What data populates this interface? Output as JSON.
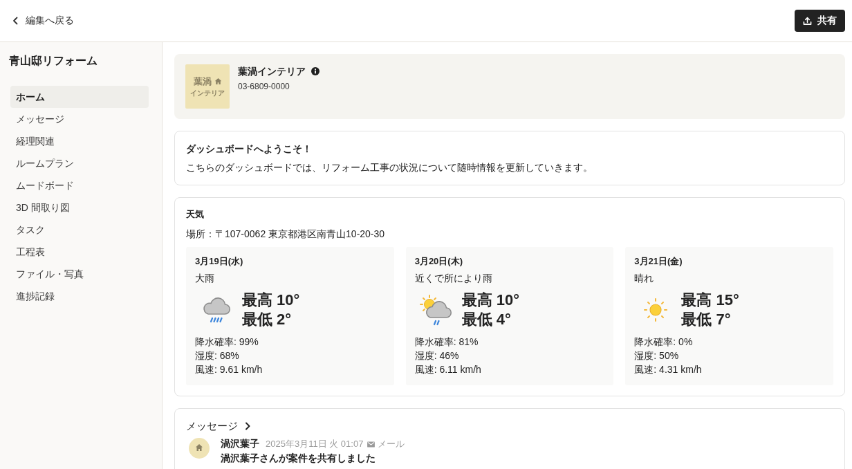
{
  "header": {
    "back_link": "編集へ戻る",
    "share_button": "共有"
  },
  "sidebar": {
    "title": "青山邸リフォーム",
    "items": [
      {
        "label": "ホーム",
        "selected": true
      },
      {
        "label": "メッセージ",
        "selected": false
      },
      {
        "label": "経理関連",
        "selected": false
      },
      {
        "label": "ルームプラン",
        "selected": false
      },
      {
        "label": "ムードボード",
        "selected": false
      },
      {
        "label": "3D 間取り図",
        "selected": false
      },
      {
        "label": "タスク",
        "selected": false
      },
      {
        "label": "工程表",
        "selected": false
      },
      {
        "label": "ファイル・写真",
        "selected": false
      },
      {
        "label": "進捗記録",
        "selected": false
      }
    ]
  },
  "company": {
    "logo": {
      "line_1": "葉渦",
      "line_2": "インテリア"
    },
    "name": "葉渦インテリア",
    "phone": "03-6809-0000"
  },
  "welcome": {
    "title": "ダッシュボードへようこそ！",
    "body": "こちらのダッシュボードでは、リフォーム工事の状況について随時情報を更新していきます。"
  },
  "weather": {
    "title": "天気",
    "location": "場所：〒107-0062 東京都港区南青山10-20-30",
    "days": [
      {
        "date": "3月19日(水)",
        "condition": "大雨",
        "kind": "heavy_rain",
        "high": "最高 10°",
        "low": "最低 2°",
        "precipitation": "降水確率: 99%",
        "humidity": "湿度: 68%",
        "wind": "風速: 9.61 km/h"
      },
      {
        "date": "3月20日(木)",
        "condition": "近くで所により雨",
        "kind": "partly_rain",
        "high": "最高 10°",
        "low": "最低 4°",
        "precipitation": "降水確率: 81%",
        "humidity": "湿度: 46%",
        "wind": "風速: 6.11 km/h"
      },
      {
        "date": "3月21日(金)",
        "condition": "晴れ",
        "kind": "sunny",
        "high": "最高 15°",
        "low": "最低 7°",
        "precipitation": "降水確率: 0%",
        "humidity": "湿度: 50%",
        "wind": "風速: 4.31 km/h"
      }
    ]
  },
  "messages": {
    "title": "メッセージ",
    "items": [
      {
        "sender": "渦沢葉子",
        "time": "2025年3月11日 火 01:07",
        "channel": "メール",
        "text": "渦沢葉子さんが案件を共有しました"
      }
    ]
  }
}
